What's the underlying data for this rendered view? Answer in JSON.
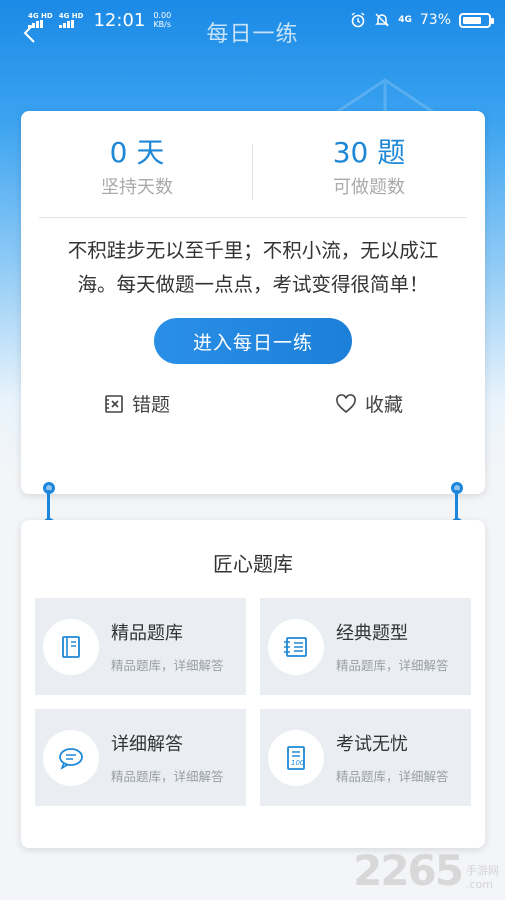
{
  "status_bar": {
    "sim1": "4G HD",
    "sim2": "4G HD",
    "time": "12:01",
    "speed_value": "0.00",
    "speed_unit": "KB/s",
    "network": "4G",
    "battery_text": "73%",
    "battery_level": 0.73
  },
  "nav": {
    "title": "每日一练"
  },
  "stats": {
    "days_value": "0 天",
    "days_label": "坚持天数",
    "questions_value": "30 题",
    "questions_label": "可做题数"
  },
  "quote": "不积跬步无以至千里；不积小流，无以成江海。每天做题一点点，考试变得很简单！",
  "enter_button": "进入每日一练",
  "actions": {
    "wrong": "错题",
    "favorites": "收藏"
  },
  "library": {
    "title": "匠心题库",
    "items": [
      {
        "title": "精品题库",
        "subtitle": "精品题库，详细解答",
        "icon": "book-icon"
      },
      {
        "title": "经典题型",
        "subtitle": "精品题库，详细解答",
        "icon": "notebook-icon"
      },
      {
        "title": "详细解答",
        "subtitle": "精品题库，详细解答",
        "icon": "chat-bubble-icon"
      },
      {
        "title": "考试无忧",
        "subtitle": "精品题库，详细解答",
        "icon": "score-paper-icon"
      }
    ]
  },
  "watermark": {
    "number": "2265",
    "cn": "手游网",
    "domain": ".com"
  },
  "colors": {
    "primary": "#1e88d6",
    "tile_bg": "#eaeef3"
  }
}
